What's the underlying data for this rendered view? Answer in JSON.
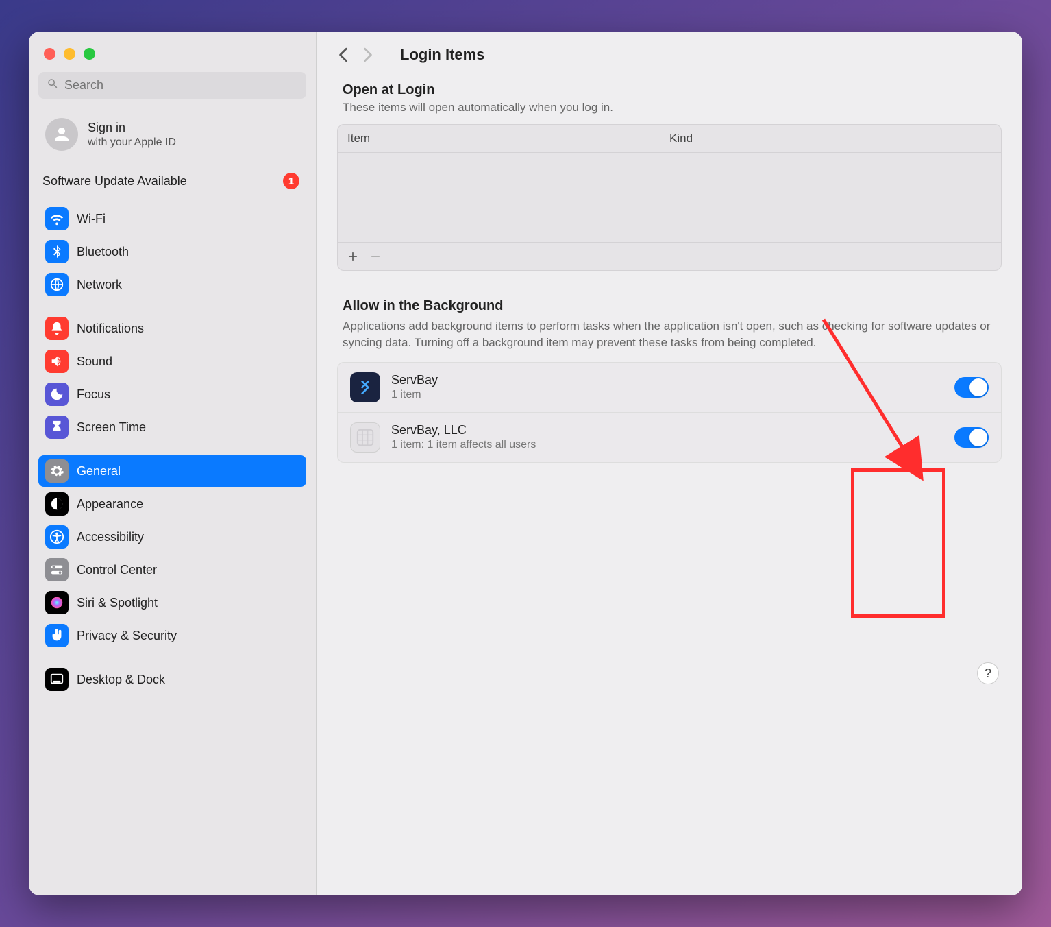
{
  "search": {
    "placeholder": "Search"
  },
  "signin": {
    "title": "Sign in",
    "subtitle": "with your Apple ID"
  },
  "update": {
    "label": "Software Update Available",
    "count": "1"
  },
  "sidebar": {
    "groups": [
      [
        {
          "label": "Wi-Fi",
          "icon": "wifi",
          "bg": "#0a7aff"
        },
        {
          "label": "Bluetooth",
          "icon": "bluetooth",
          "bg": "#0a7aff"
        },
        {
          "label": "Network",
          "icon": "network",
          "bg": "#0a7aff"
        }
      ],
      [
        {
          "label": "Notifications",
          "icon": "bell",
          "bg": "#ff3b30"
        },
        {
          "label": "Sound",
          "icon": "sound",
          "bg": "#ff3b30"
        },
        {
          "label": "Focus",
          "icon": "moon",
          "bg": "#5856d6"
        },
        {
          "label": "Screen Time",
          "icon": "hourglass",
          "bg": "#5856d6"
        }
      ],
      [
        {
          "label": "General",
          "icon": "gear",
          "bg": "#8e8e93",
          "selected": true
        },
        {
          "label": "Appearance",
          "icon": "appearance",
          "bg": "#000"
        },
        {
          "label": "Accessibility",
          "icon": "accessibility",
          "bg": "#0a7aff"
        },
        {
          "label": "Control Center",
          "icon": "switches",
          "bg": "#8e8e93"
        },
        {
          "label": "Siri & Spotlight",
          "icon": "siri",
          "bg": "#000"
        },
        {
          "label": "Privacy & Security",
          "icon": "hand",
          "bg": "#0a7aff"
        }
      ],
      [
        {
          "label": "Desktop & Dock",
          "icon": "dock",
          "bg": "#000"
        }
      ]
    ]
  },
  "header": {
    "title": "Login Items"
  },
  "openAtLogin": {
    "title": "Open at Login",
    "subtitle": "These items will open automatically when you log in.",
    "columns": {
      "item": "Item",
      "kind": "Kind"
    }
  },
  "background": {
    "title": "Allow in the Background",
    "subtitle": "Applications add background items to perform tasks when the application isn't open, such as checking for software updates or syncing data. Turning off a background item may prevent these tasks from being completed.",
    "items": [
      {
        "name": "ServBay",
        "detail": "1 item",
        "iconBg": "#1a2340",
        "on": true
      },
      {
        "name": "ServBay, LLC",
        "detail": "1 item: 1 item affects all users",
        "iconBg": "#e4e2e5",
        "on": true
      }
    ]
  },
  "help": "?"
}
